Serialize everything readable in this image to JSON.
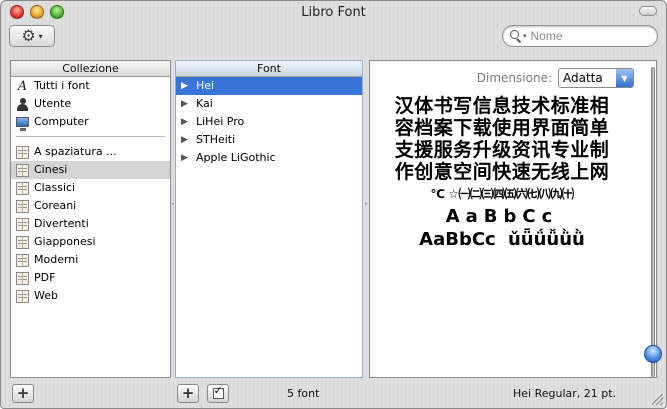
{
  "window": {
    "title": "Libro Font"
  },
  "toolbar": {
    "action_icon": "gear-icon",
    "action_caret": "▾"
  },
  "search": {
    "placeholder": "Nome",
    "value": ""
  },
  "collections": {
    "header": "Collezione",
    "system": [
      {
        "label": "Tutti i font",
        "icon": "font-a-icon"
      },
      {
        "label": "Utente",
        "icon": "user-icon"
      },
      {
        "label": "Computer",
        "icon": "computer-icon"
      }
    ],
    "items": [
      {
        "label": "A spaziatura ...",
        "selected": false
      },
      {
        "label": "Cinesi",
        "selected": true
      },
      {
        "label": "Classici",
        "selected": false
      },
      {
        "label": "Coreani",
        "selected": false
      },
      {
        "label": "Divertenti",
        "selected": false
      },
      {
        "label": "Giapponesi",
        "selected": false
      },
      {
        "label": "Moderni",
        "selected": false
      },
      {
        "label": "PDF",
        "selected": false
      },
      {
        "label": "Web",
        "selected": false
      }
    ]
  },
  "fonts": {
    "header": "Font",
    "items": [
      {
        "label": "Hei",
        "selected": true
      },
      {
        "label": "Kai",
        "selected": false
      },
      {
        "label": "LiHei Pro",
        "selected": false
      },
      {
        "label": "STHeiti",
        "selected": false
      },
      {
        "label": "Apple LiGothic",
        "selected": false
      }
    ]
  },
  "preview": {
    "size_label": "Dimensione:",
    "size_value": "Adatta",
    "sample_lines": [
      "汉体书写信息技术标准相",
      "容档案下载使用界面简单",
      "支援服务升级资讯专业制",
      "作创意空间快速无线上网",
      "℃ ☆㈠㈡㈢㈣㈤㈥㈦㈧㈨㈩",
      "AaBbCc",
      "AaBbCc ǔǖǘǚǜǜ"
    ]
  },
  "status": {
    "count": "5 font",
    "font_info": "Hei Regular, 21 pt."
  }
}
